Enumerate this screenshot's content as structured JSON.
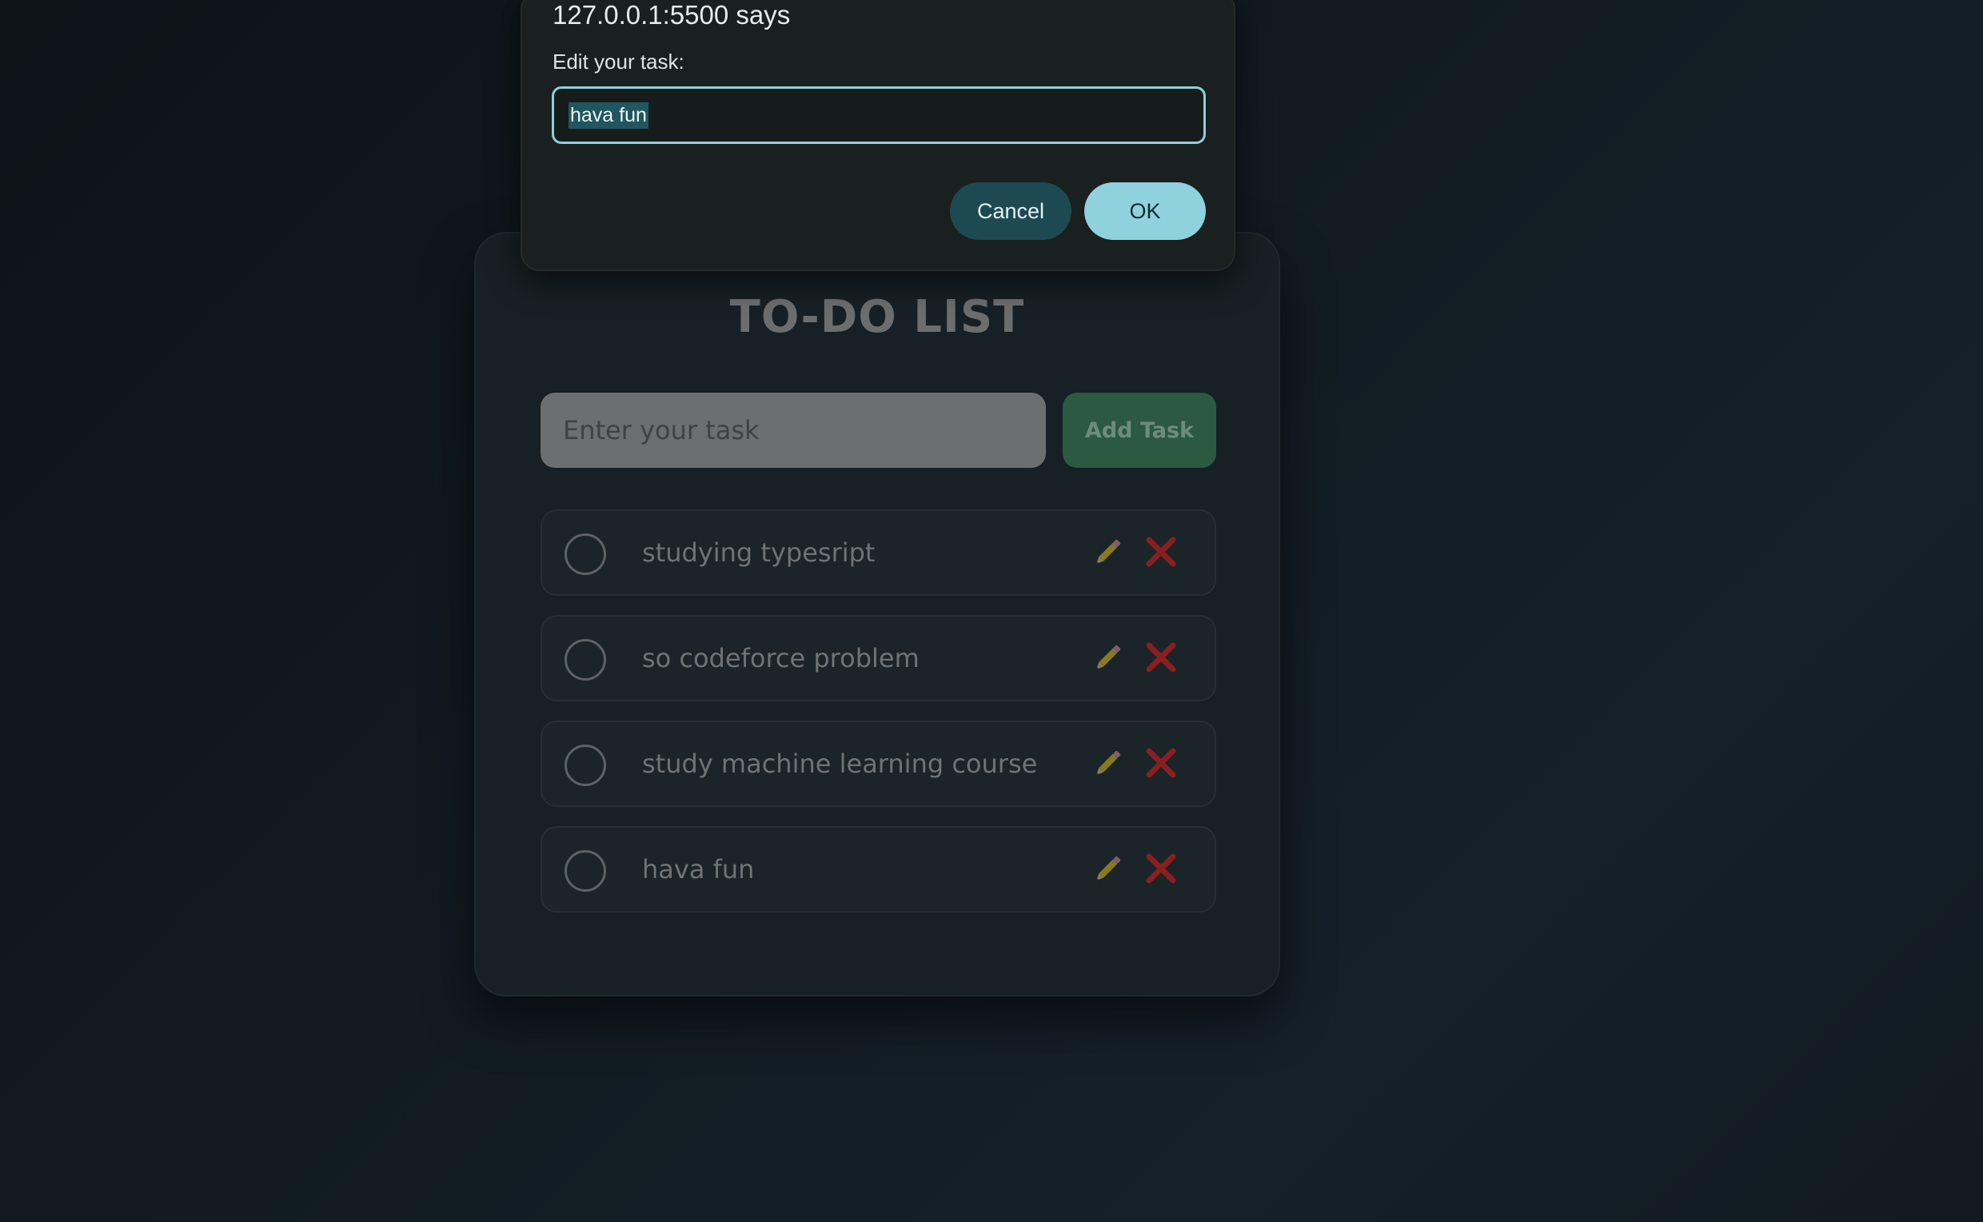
{
  "dialog": {
    "origin": "127.0.0.1:5500 says",
    "message": "Edit your task:",
    "input_value": "hava fun",
    "cancel_label": "Cancel",
    "ok_label": "OK"
  },
  "app": {
    "title": "TO-DO LIST",
    "input_placeholder": "Enter your task",
    "add_button_label": "Add Task",
    "tasks": [
      {
        "text": "studying typesript",
        "completed": false
      },
      {
        "text": "so codeforce problem",
        "completed": false
      },
      {
        "text": "study machine learning course",
        "completed": false
      },
      {
        "text": "hava fun",
        "completed": false
      }
    ],
    "icons": {
      "edit": "pencil-icon",
      "delete": "cross-mark-icon"
    }
  },
  "colors": {
    "dialog_accent": "#8fd2de",
    "add_button": "#2b5a41",
    "delete_icon": "#8a1f1f"
  }
}
